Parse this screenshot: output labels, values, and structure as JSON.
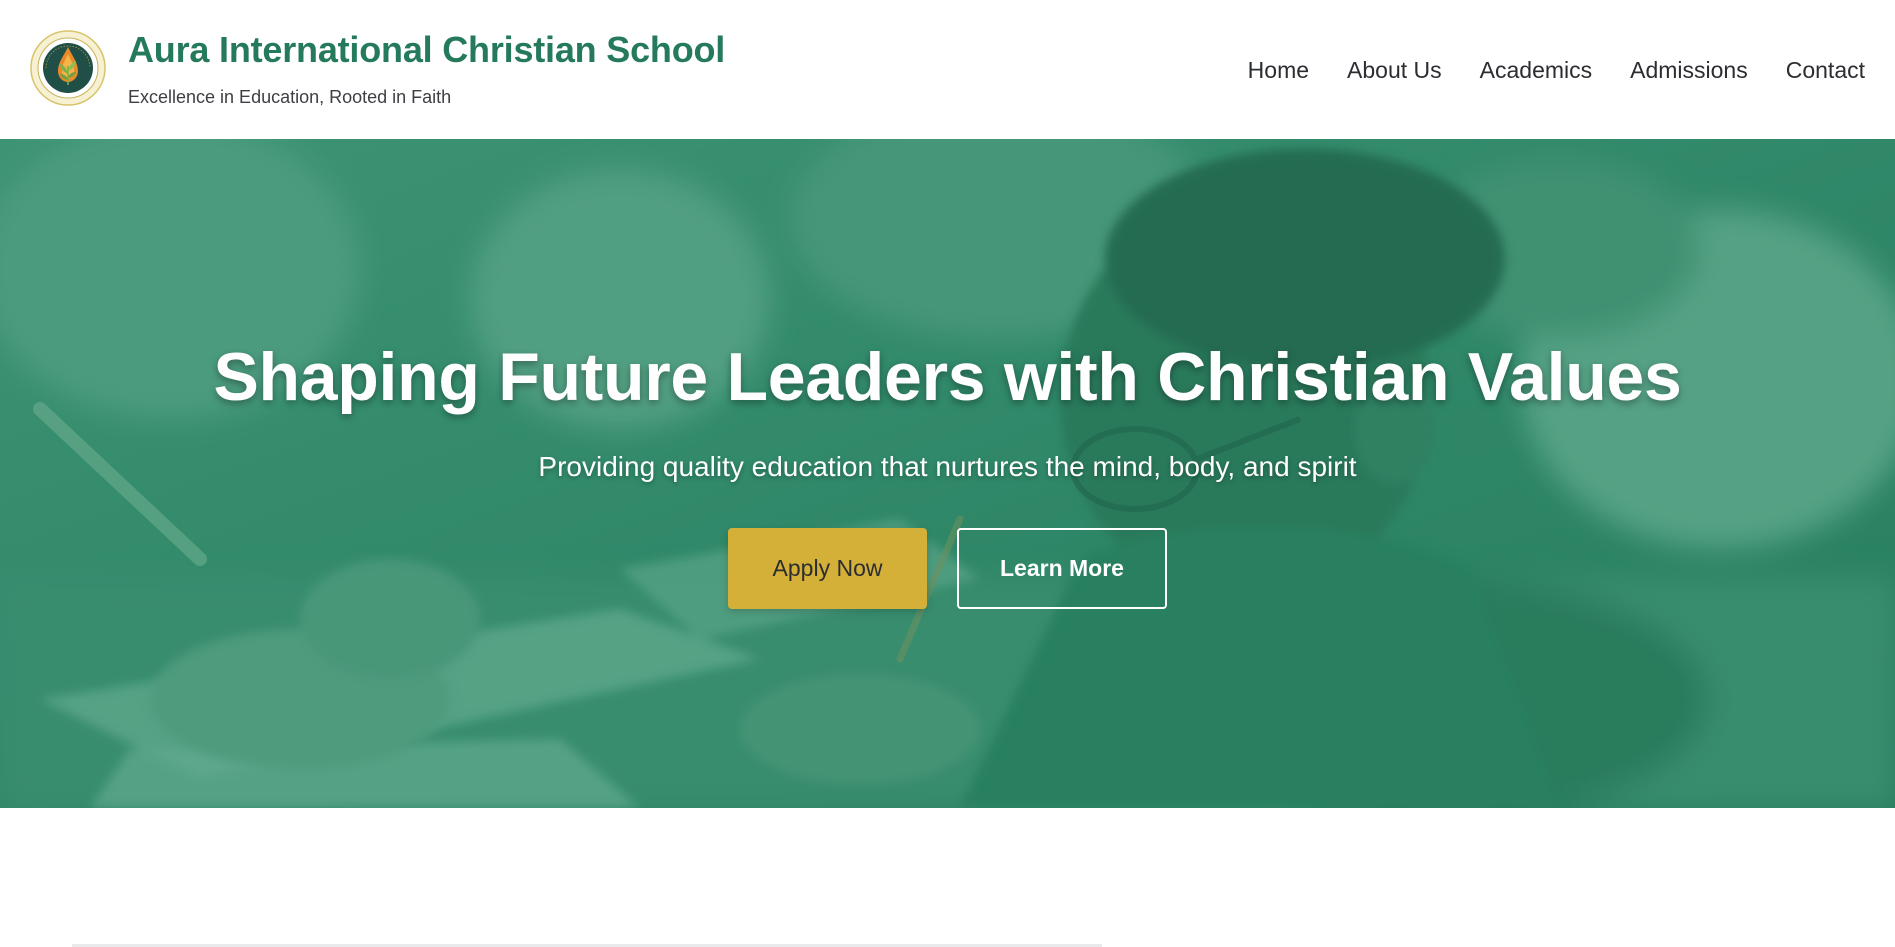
{
  "header": {
    "title": "Aura International Christian School",
    "tagline": "Excellence in Education, Rooted in Faith",
    "logo_icon": "school-crest-icon"
  },
  "nav": {
    "items": [
      {
        "label": "Home"
      },
      {
        "label": "About Us"
      },
      {
        "label": "Academics"
      },
      {
        "label": "Admissions"
      },
      {
        "label": "Contact"
      }
    ]
  },
  "hero": {
    "title": "Shaping Future Leaders with Christian Values",
    "subtitle": "Providing quality education that nurtures the mind, body, and spirit",
    "primary_button": "Apply Now",
    "secondary_button": "Learn More"
  },
  "colors": {
    "brand_green": "#247a5b",
    "hero_overlay": "#2a8564",
    "accent_gold": "#d4b038",
    "text_dark": "#2b2d31",
    "white": "#ffffff"
  }
}
